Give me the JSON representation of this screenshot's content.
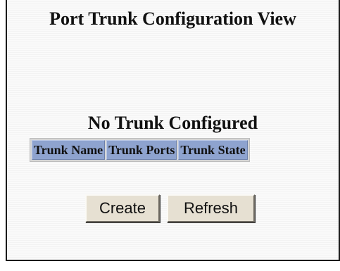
{
  "page": {
    "title": "Port Trunk Configuration View",
    "status_message": "No Trunk Configured"
  },
  "trunk_table": {
    "columns": [
      "Trunk Name",
      "Trunk Ports",
      "Trunk State"
    ],
    "rows": [],
    "header_color": "#8ea3cf"
  },
  "actions": {
    "create_label": "Create",
    "refresh_label": "Refresh",
    "button_color": "#e6e0d2"
  }
}
